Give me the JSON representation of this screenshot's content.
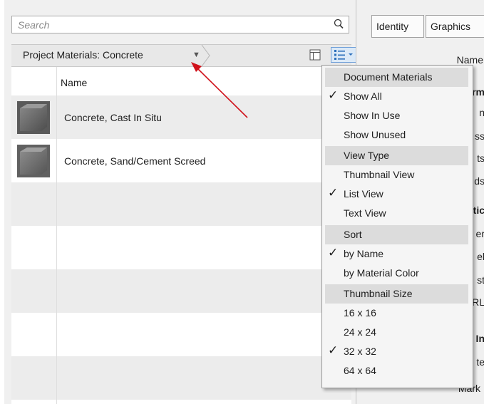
{
  "search": {
    "placeholder": "Search"
  },
  "breadcrumb": {
    "title": "Project Materials: Concrete"
  },
  "list": {
    "column_header": "Name",
    "rows": [
      {
        "label": "Concrete, Cast In Situ"
      },
      {
        "label": "Concrete, Sand/Cement Screed"
      }
    ]
  },
  "tabs": [
    {
      "label": "Identity"
    },
    {
      "label": "Graphics"
    }
  ],
  "properties": {
    "name_header": "Name",
    "items": [
      "rm",
      "n",
      "ss",
      "ts",
      "ds",
      "atic",
      "er",
      "el",
      "st",
      "RL",
      "n In",
      "te",
      "Mark"
    ]
  },
  "menu": {
    "items": [
      {
        "label": "Document Materials",
        "header": true,
        "checked": false
      },
      {
        "label": "Show All",
        "header": false,
        "checked": true
      },
      {
        "label": "Show In Use",
        "header": false,
        "checked": false
      },
      {
        "label": "Show Unused",
        "header": false,
        "checked": false
      },
      {
        "label": "View Type",
        "header": true,
        "checked": false
      },
      {
        "label": "Thumbnail View",
        "header": false,
        "checked": false
      },
      {
        "label": "List View",
        "header": false,
        "checked": true
      },
      {
        "label": "Text View",
        "header": false,
        "checked": false
      },
      {
        "label": "Sort",
        "header": true,
        "checked": false
      },
      {
        "label": "by Name",
        "header": false,
        "checked": true
      },
      {
        "label": "by Material Color",
        "header": false,
        "checked": false
      },
      {
        "label": "Thumbnail Size",
        "header": true,
        "checked": false
      },
      {
        "label": "16 x 16",
        "header": false,
        "checked": false
      },
      {
        "label": "24 x 24",
        "header": false,
        "checked": false
      },
      {
        "label": "32 x 32",
        "header": false,
        "checked": true
      },
      {
        "label": "64 x 64",
        "header": false,
        "checked": false
      }
    ]
  },
  "colors": {
    "arrow": "#d0121b",
    "highlight": "#dbe9f7",
    "menu_header": "#dcdcdc"
  }
}
